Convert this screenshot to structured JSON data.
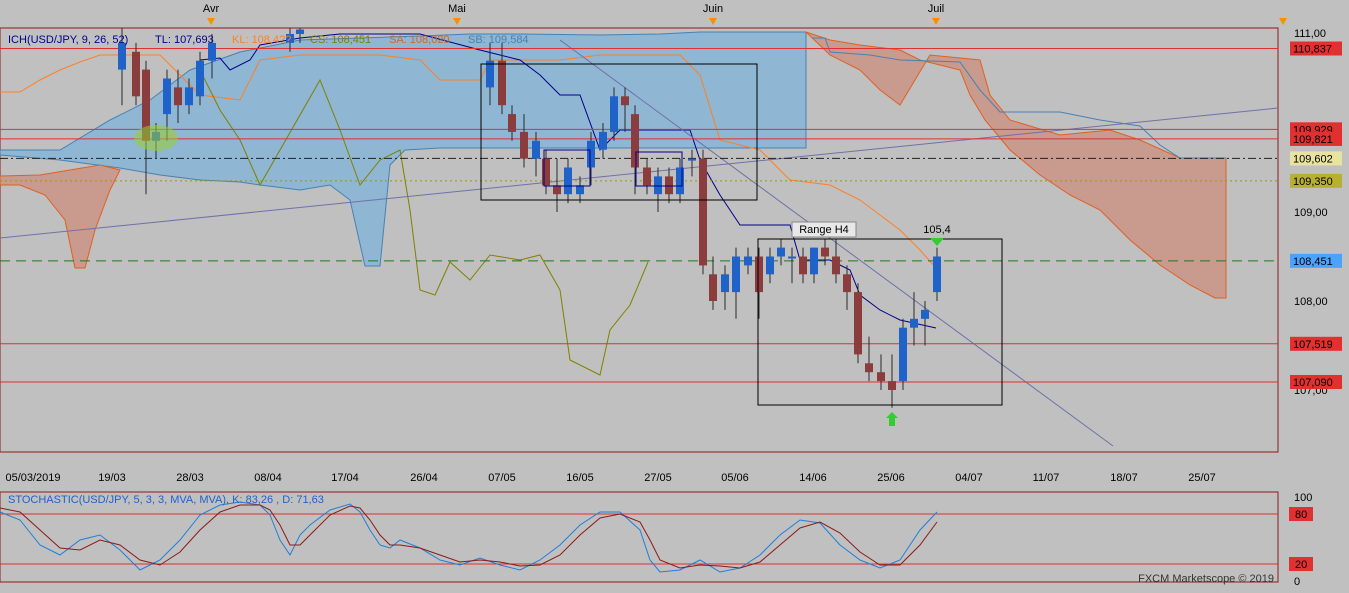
{
  "chart_data": [
    {
      "type": "candlestick",
      "title": "ICH(USD/JPY, 9, 26, 52)",
      "indicator_legend": [
        {
          "label": "ICH(USD/JPY, 9, 26, 52)",
          "color": "#00008b"
        },
        {
          "label": "TL: 107,693",
          "color": "#00008b"
        },
        {
          "label": "KL: 108,4??",
          "color": "#ff7f27"
        },
        {
          "label": "CS: 108,451",
          "color": "#808000"
        },
        {
          "label": "SA: 108,020",
          "color": "#d2691e"
        },
        {
          "label": "SB: 109,584",
          "color": "#4682b4"
        }
      ],
      "month_labels": [
        "Avr",
        "Mai",
        "Juin",
        "Juil"
      ],
      "x_ticks": [
        "05/03/2019",
        "19/03",
        "28/03",
        "08/04",
        "17/04",
        "26/04",
        "07/05",
        "16/05",
        "27/05",
        "05/06",
        "14/06",
        "25/06",
        "04/07",
        "11/07",
        "18/07",
        "25/07"
      ],
      "y_ticks": [
        "111,00",
        "109,00",
        "108,00",
        "107,00"
      ],
      "ylim": [
        105.6,
        111.1
      ],
      "price_levels": [
        {
          "value": 110.837,
          "label": "110,837",
          "style": "red-line"
        },
        {
          "value": 109.929,
          "label": "109,929",
          "style": "red-line"
        },
        {
          "value": 109.821,
          "label": "109,821",
          "style": "red-line"
        },
        {
          "value": 109.602,
          "label": "109,602",
          "style": "black-dashdot"
        },
        {
          "value": 109.35,
          "label": "109,350",
          "style": "olive-dotted"
        },
        {
          "value": 108.451,
          "label": "108,451",
          "style": "green-dashed"
        },
        {
          "value": 107.519,
          "label": "107,519",
          "style": "red-line"
        },
        {
          "value": 107.09,
          "label": "107,090",
          "style": "red-line"
        }
      ],
      "annotations": [
        {
          "text": "Range H4"
        },
        {
          "text": "105,4"
        }
      ],
      "candles_sample": [
        {
          "date": "07/05",
          "open": 110.7,
          "high": 110.9,
          "low": 110.0,
          "close": 110.1
        },
        {
          "date": "16/05",
          "open": 109.4,
          "high": 109.6,
          "low": 109.2,
          "close": 109.5
        },
        {
          "date": "27/05",
          "open": 109.3,
          "high": 109.6,
          "low": 109.2,
          "close": 109.5
        },
        {
          "date": "05/06",
          "open": 108.3,
          "high": 108.5,
          "low": 107.9,
          "close": 108.2
        },
        {
          "date": "14/06",
          "open": 108.5,
          "high": 108.6,
          "low": 108.3,
          "close": 108.4
        },
        {
          "date": "25/06",
          "open": 107.2,
          "high": 107.4,
          "low": 106.8,
          "close": 107.1
        },
        {
          "date": "02/07",
          "open": 108.2,
          "high": 108.6,
          "low": 108.1,
          "close": 108.5
        }
      ],
      "colors": {
        "up": "#1f62c8",
        "down": "#8b3c3c",
        "kumo_up": "#8fb6d2",
        "kumo_down": "#c99a8e",
        "background": "#c0c0c0"
      }
    },
    {
      "type": "line",
      "title": "STOCHASTIC(USD/JPY, 5, 3, 3, MVA, MVA), K: 83,26 , D: 71,63",
      "series": [
        {
          "name": "K",
          "color": "#1f7fd8"
        },
        {
          "name": "D",
          "color": "#8b1a1a"
        }
      ],
      "y_ticks": [
        "100",
        "80",
        "20",
        "0"
      ],
      "ylim": [
        0,
        100
      ],
      "levels": [
        80,
        20
      ]
    }
  ],
  "footer": {
    "brand": "FXCM Marketscope © 2019"
  }
}
